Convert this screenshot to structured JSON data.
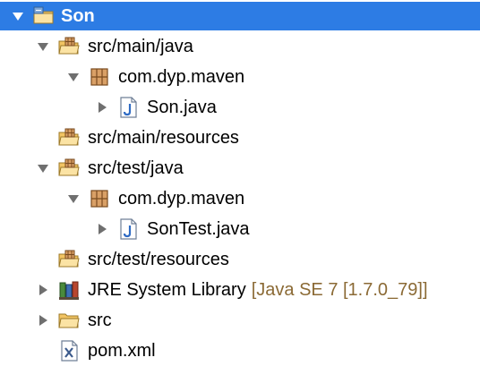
{
  "colors": {
    "selection": "#2d7ce4",
    "decoration": "#8b6a35",
    "twisty": "#6f6f6f"
  },
  "tree": {
    "rows": [
      {
        "label": "Son",
        "icon": "project-folder-icon",
        "state": "expanded",
        "selected": true
      },
      {
        "label": "src/main/java",
        "icon": "source-folder-icon",
        "state": "expanded"
      },
      {
        "label": "com.dyp.maven",
        "icon": "package-icon",
        "state": "expanded"
      },
      {
        "label": "Son.java",
        "icon": "java-file-icon",
        "state": "collapsed"
      },
      {
        "label": "src/main/resources",
        "icon": "source-folder-icon",
        "state": "none"
      },
      {
        "label": "src/test/java",
        "icon": "source-folder-icon",
        "state": "expanded"
      },
      {
        "label": "com.dyp.maven",
        "icon": "package-icon",
        "state": "expanded"
      },
      {
        "label": "SonTest.java",
        "icon": "java-file-icon",
        "state": "collapsed"
      },
      {
        "label": "src/test/resources",
        "icon": "source-folder-icon",
        "state": "none"
      },
      {
        "label": "JRE System Library",
        "decoration": "[Java SE 7 [1.7.0_79]]",
        "icon": "library-icon",
        "state": "collapsed"
      },
      {
        "label": "src",
        "icon": "folder-icon",
        "state": "collapsed"
      },
      {
        "label": "pom.xml",
        "icon": "xml-file-icon",
        "state": "none"
      }
    ]
  }
}
